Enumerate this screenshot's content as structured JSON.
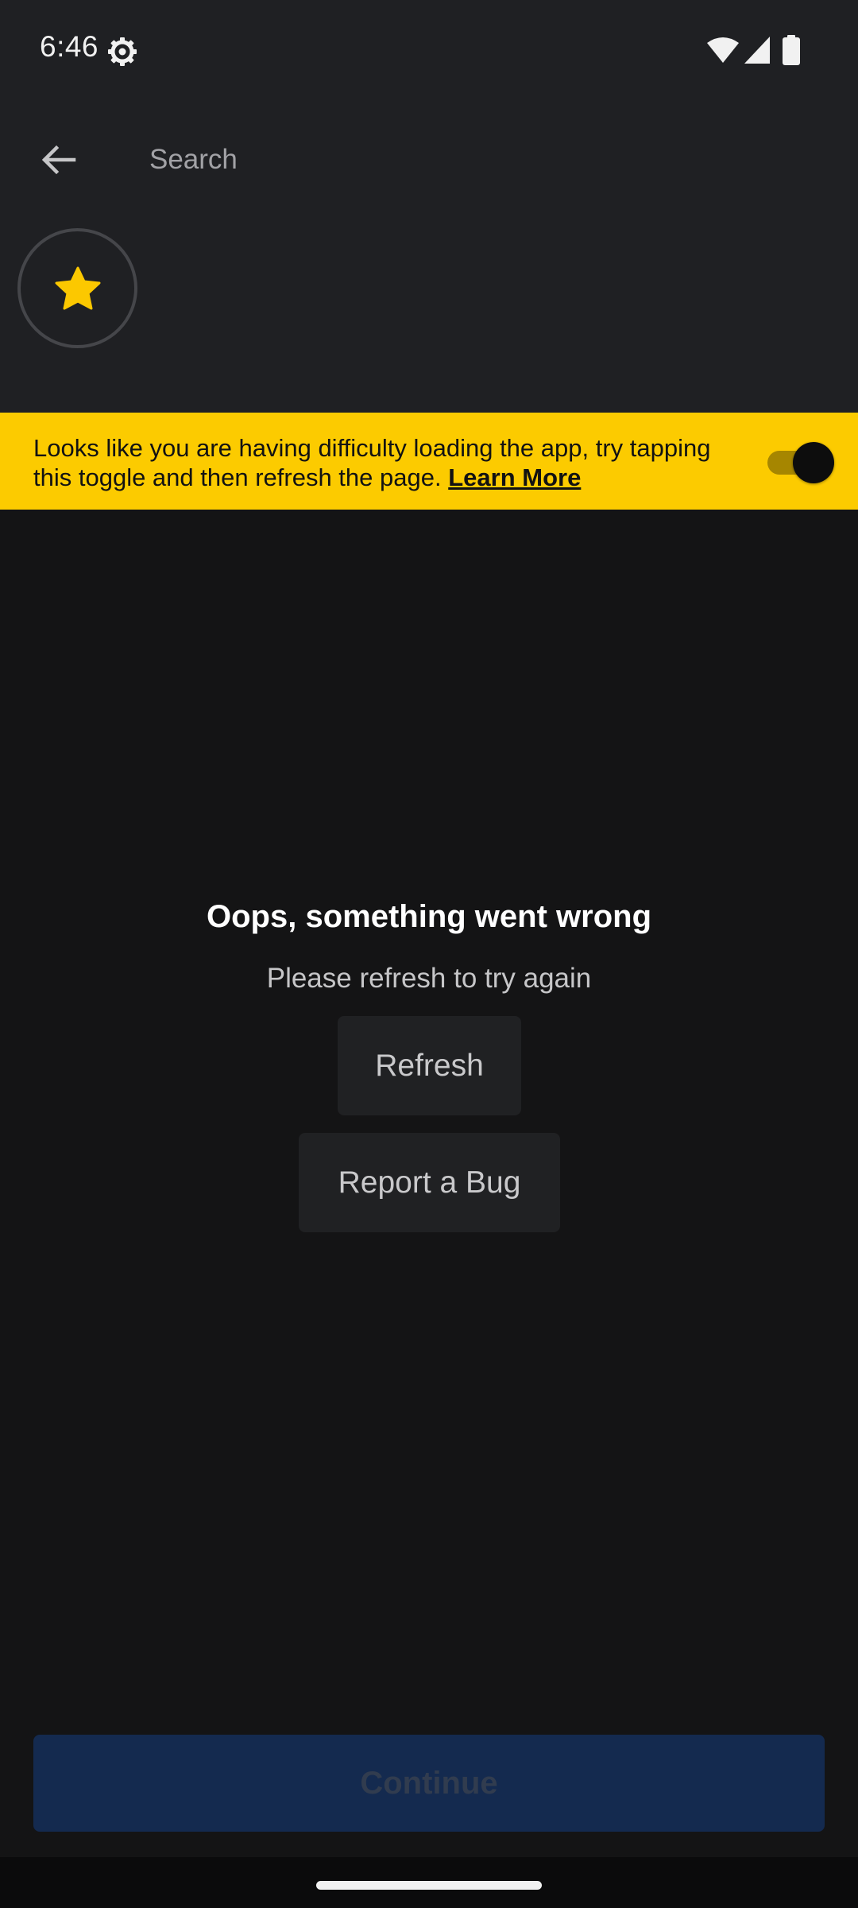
{
  "status_bar": {
    "time": "6:46",
    "settings_icon": "gear-icon",
    "wifi_icon": "wifi-icon",
    "signal_icon": "cell-signal-icon",
    "battery_icon": "battery-icon"
  },
  "search": {
    "back_icon": "arrow-back-icon",
    "placeholder": "Search",
    "value": ""
  },
  "favorite": {
    "icon": "star-icon",
    "icon_color": "#fcc800"
  },
  "banner": {
    "message": "Looks like you are having difficulty loading the app, try tapping this toggle and then refresh the page.",
    "link_label": "Learn More",
    "toggle_on": true,
    "background_color": "#fccb00"
  },
  "error": {
    "title": "Oops, something went wrong",
    "subtitle": "Please refresh to try again",
    "refresh_label": "Refresh",
    "report_bug_label": "Report a Bug"
  },
  "footer": {
    "continue_label": "Continue",
    "continue_enabled": false,
    "continue_color": "#142a4f"
  }
}
